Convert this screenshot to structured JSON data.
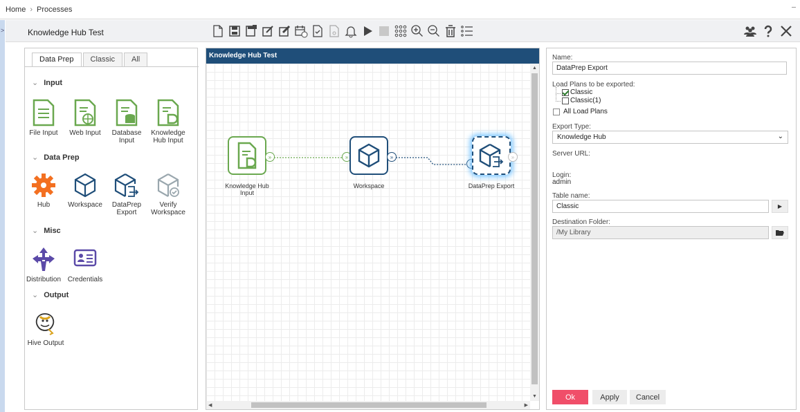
{
  "breadcrumb": {
    "home": "Home",
    "separator": "›",
    "current": "Processes"
  },
  "process": {
    "title": "Knowledge Hub Test"
  },
  "toolbar": {
    "icons": [
      "new-icon",
      "save-icon",
      "save-as-icon",
      "edit-icon",
      "edit-properties-icon",
      "schedule-icon",
      "validate-icon",
      "export-icon",
      "notification-bell-icon",
      "run-icon",
      "stop-icon",
      "grid-icon",
      "zoom-in-icon",
      "zoom-out-icon",
      "delete-icon",
      "list-icon"
    ],
    "right_icons": [
      "users-icon",
      "help-icon",
      "close-icon"
    ]
  },
  "palette": {
    "tabs": [
      "Data Prep",
      "Classic",
      "All"
    ],
    "active_tab": "Data Prep",
    "sections": {
      "input": {
        "title": "Input",
        "items": [
          "File Input",
          "Web Input",
          "Database Input",
          "Knowledge Hub Input"
        ]
      },
      "dataprep": {
        "title": "Data Prep",
        "items": [
          "Hub",
          "Workspace",
          "DataPrep Export",
          "Verify Workspace"
        ]
      },
      "misc": {
        "title": "Misc",
        "items": [
          "Distribution",
          "Credentials"
        ]
      },
      "output": {
        "title": "Output",
        "items": [
          "Hive Output"
        ]
      }
    }
  },
  "canvas": {
    "title": "Knowledge Hub Test",
    "nodes": [
      {
        "label": "Knowledge Hub Input"
      },
      {
        "label": "Workspace"
      },
      {
        "label": "DataPrep Export"
      }
    ]
  },
  "properties": {
    "name_label": "Name:",
    "name_value": "DataPrep Export",
    "load_plans_label": "Load Plans to be exported:",
    "load_plans": [
      {
        "label": "Classic",
        "checked": true
      },
      {
        "label": "Classic(1)",
        "checked": false
      }
    ],
    "all_load_plans_label": "All Load Plans",
    "export_type_label": "Export Type:",
    "export_type_value": "Knowledge Hub",
    "server_url_label": "Server URL:",
    "login_label": "Login:",
    "login_value": "admin",
    "table_name_label": "Table name:",
    "table_name_value": "Classic",
    "destination_label": "Destination Folder:",
    "destination_value": "/My Library",
    "buttons": {
      "ok": "Ok",
      "apply": "Apply",
      "cancel": "Cancel"
    }
  },
  "colors": {
    "header": "#1f4e79",
    "accent_green": "#6aa84f",
    "accent_blue": "#1f4e79",
    "ok_button": "#f04e69",
    "hub_orange": "#f37021",
    "purple": "#5b4aa8"
  }
}
